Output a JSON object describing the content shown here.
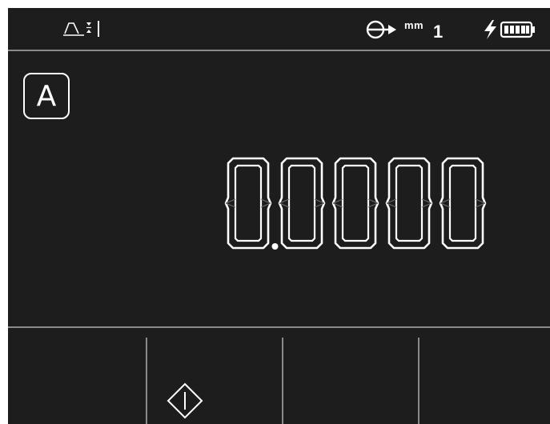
{
  "status_bar": {
    "filter_icon": "filter-icon",
    "unit_icon": "reference-arrow-icon",
    "unit_label": "mm",
    "resolution": "1",
    "power_icon": "lightning-icon",
    "battery_icon": "battery-full-icon",
    "battery_level": 1.0
  },
  "axis": {
    "label": "A"
  },
  "readout": {
    "value": "0.0000",
    "digit_count": 5,
    "decimal_after_digit": 1
  },
  "softkeys": [
    {
      "icon": null
    },
    {
      "icon": "datum-diamond-icon"
    },
    {
      "icon": null
    },
    {
      "icon": null
    }
  ],
  "colors": {
    "background": "#1d1d1d",
    "foreground": "#ffffff",
    "divider": "#8a8a8a"
  }
}
